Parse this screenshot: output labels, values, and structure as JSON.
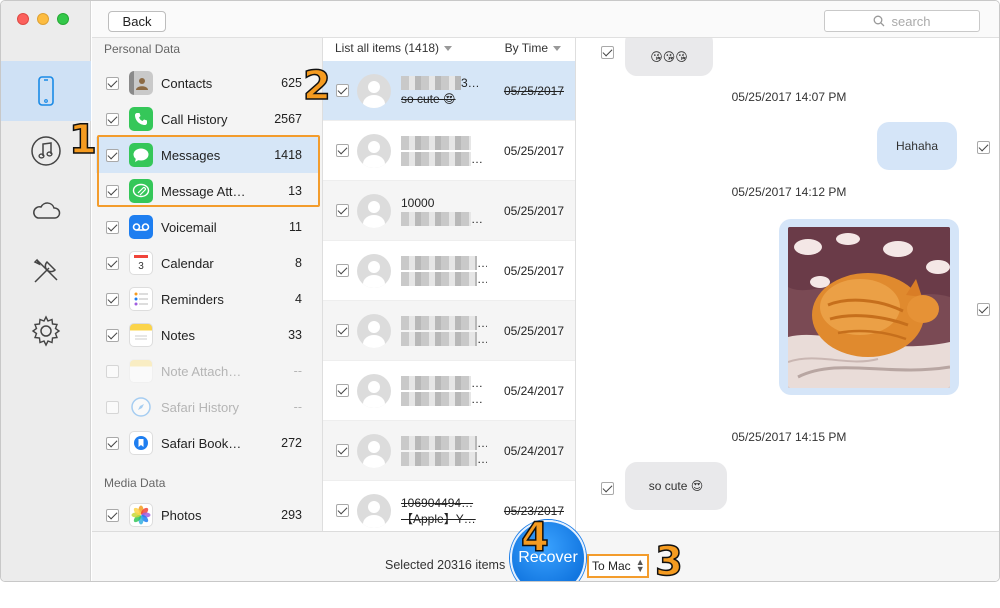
{
  "topbar": {
    "back_label": "Back",
    "search_placeholder": "search"
  },
  "rail": {
    "items": [
      {
        "icon": "iphone-icon",
        "active": true
      },
      {
        "icon": "music-icon",
        "active": false
      },
      {
        "icon": "cloud-icon",
        "active": false
      },
      {
        "icon": "tools-icon",
        "active": false
      },
      {
        "icon": "gear-icon",
        "active": false
      }
    ]
  },
  "categories": {
    "personal_title": "Personal Data",
    "media_title": "Media Data",
    "items": [
      {
        "label": "Contacts",
        "count": "625",
        "checked": true,
        "icon": "contacts-icon"
      },
      {
        "label": "Call History",
        "count": "2567",
        "checked": true,
        "icon": "phone-icon"
      },
      {
        "label": "Messages",
        "count": "1418",
        "checked": true,
        "icon": "messages-icon",
        "selected": true
      },
      {
        "label": "Message Att…",
        "count": "13",
        "checked": true,
        "icon": "message-attachment-icon"
      },
      {
        "label": "Voicemail",
        "count": "11",
        "checked": true,
        "icon": "voicemail-icon"
      },
      {
        "label": "Calendar",
        "count": "8",
        "checked": true,
        "icon": "calendar-icon"
      },
      {
        "label": "Reminders",
        "count": "4",
        "checked": true,
        "icon": "reminders-icon"
      },
      {
        "label": "Notes",
        "count": "33",
        "checked": true,
        "icon": "notes-icon"
      },
      {
        "label": "Note Attach…",
        "count": "--",
        "checked": false,
        "disabled": true,
        "icon": "note-attachment-icon"
      },
      {
        "label": "Safari History",
        "count": "--",
        "checked": false,
        "disabled": true,
        "icon": "safari-icon"
      },
      {
        "label": "Safari Book…",
        "count": "272",
        "checked": true,
        "icon": "safari-bookmark-icon"
      }
    ],
    "media_items": [
      {
        "label": "Photos",
        "count": "293",
        "checked": true,
        "icon": "photos-icon"
      }
    ]
  },
  "list": {
    "header_left": "List all items (1418)",
    "header_right": "By Time",
    "rows": [
      {
        "line1": "3…",
        "line2": "so cute 😍",
        "date": "05/25/2017",
        "deleted": true,
        "selected": true
      },
      {
        "line1": "",
        "line2": "…",
        "date": "05/25/2017"
      },
      {
        "line1": "10000",
        "line2": "…",
        "date": "05/25/2017"
      },
      {
        "line1": "…",
        "line2": "…",
        "date": "05/25/2017"
      },
      {
        "line1": "…",
        "line2": "…",
        "date": "05/25/2017"
      },
      {
        "line1": "…",
        "line2": "…",
        "date": "05/24/2017"
      },
      {
        "line1": "…",
        "line2": "…",
        "date": "05/24/2017"
      },
      {
        "line1": "106904494…",
        "line2": "【Apple】Y…",
        "date": "05/23/2017",
        "deleted": true
      }
    ]
  },
  "conversation": {
    "first_bubble": "😘😘😘",
    "ts1": "05/25/2017 14:07 PM",
    "hahaha": "Hahaha",
    "ts2": "05/25/2017 14:12 PM",
    "ts3": "05/25/2017 14:15 PM",
    "so_cute": "so cute 😍"
  },
  "bottom": {
    "selected_text": "Selected 20316 items",
    "recover_label": "Recover",
    "destination": "To Mac"
  },
  "annotations": [
    "1",
    "2",
    "3",
    "4"
  ],
  "colors": {
    "accent": "#1276e0",
    "annotation": "#f39c2c",
    "selected_row": "#d6e6f7"
  }
}
